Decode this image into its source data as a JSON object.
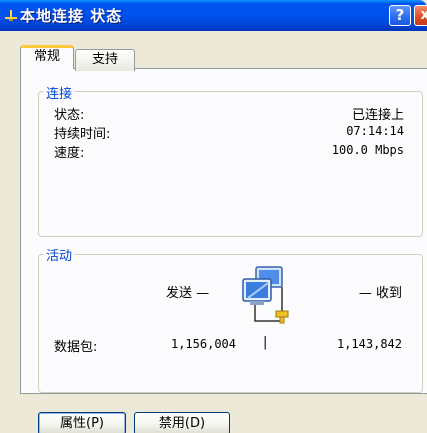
{
  "window": {
    "title": "本地连接 状态",
    "help_label": "?",
    "close_label": "x"
  },
  "tabs": [
    {
      "label": "常规",
      "selected": true
    },
    {
      "label": "支持",
      "selected": false
    }
  ],
  "connection": {
    "group_title": "连接",
    "status_label": "状态:",
    "status_value": "已连接上",
    "duration_label": "持续时间:",
    "duration_value": "07:14:14",
    "speed_label": "速度:",
    "speed_value": "100.0 Mbps"
  },
  "activity": {
    "group_title": "活动",
    "sent_label": "发送 —",
    "received_label": "— 收到",
    "packets_label": "数据包:",
    "packets_sent": "1,156,004",
    "packets_received": "1,143,842",
    "separator": "|"
  },
  "buttons": {
    "properties_label": "属性(P)",
    "disable_label": "禁用(D)"
  },
  "colors": {
    "titlebar": "#0053ee",
    "group_title": "#0046d5",
    "window_bg": "#ece9d8",
    "tab_highlight": "#ffc83c"
  },
  "icons": {
    "title": "network-connection-icon",
    "activity": "network-computers-icon"
  }
}
